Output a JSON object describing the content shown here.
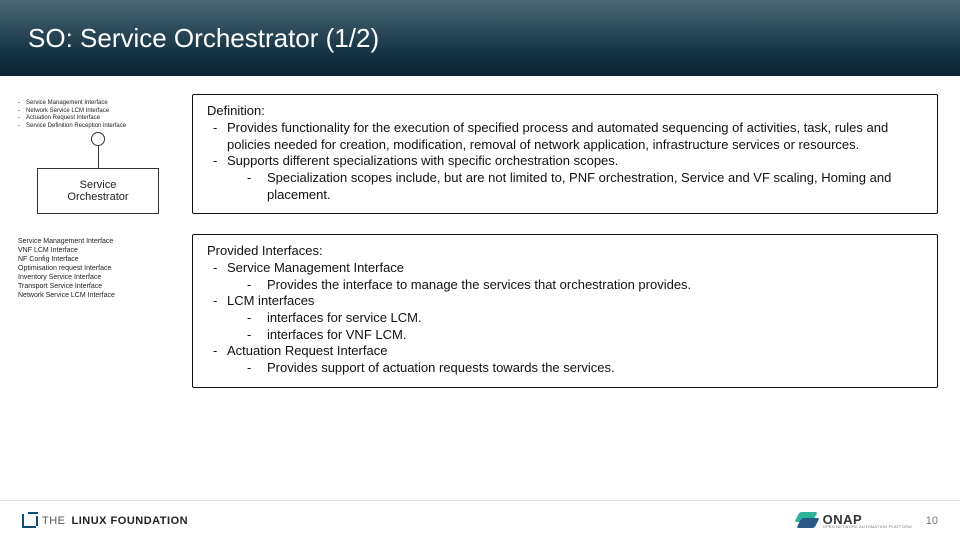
{
  "title": "SO: Service Orchestrator (1/2)",
  "top_iface": [
    "Service Management Interface",
    "Network Service LCM Interface",
    "Actuation Request Interface",
    "Service Definition Reception interface"
  ],
  "uml": {
    "l1": "Service",
    "l2": "Orchestrator"
  },
  "bottom_iface": [
    "Service Management Interface",
    "VNF LCM Interface",
    "NF Config Interface",
    "Optimisation request Interface",
    "Inventory Service Interface",
    "Transport Service Interface",
    "Network Service LCM Interface"
  ],
  "panel1": {
    "header": "Definition:",
    "items": [
      {
        "lvl": 1,
        "text": "Provides functionality for the execution of specified process and automated sequencing of activities, task, rules and policies needed for creation, modification, removal of network application, infrastructure services or resources."
      },
      {
        "lvl": 1,
        "text": "Supports different specializations with specific orchestration scopes."
      },
      {
        "lvl": 2,
        "text": "Specialization scopes include, but are not limited to, PNF orchestration, Service and VF scaling, Homing and placement."
      }
    ]
  },
  "panel2": {
    "header": "Provided Interfaces:",
    "items": [
      {
        "lvl": 1,
        "text": "Service Management Interface"
      },
      {
        "lvl": 2,
        "text": "Provides the interface to manage the services that orchestration provides."
      },
      {
        "lvl": 1,
        "text": "LCM interfaces"
      },
      {
        "lvl": 2,
        "text": "interfaces for service LCM."
      },
      {
        "lvl": 2,
        "text": "interfaces for VNF LCM."
      },
      {
        "lvl": 1,
        "text": "Actuation Request Interface"
      },
      {
        "lvl": 2,
        "text": "Provides support of actuation requests towards the services."
      }
    ]
  },
  "footer": {
    "lf_the": "THE",
    "lf_name": "LINUX FOUNDATION",
    "onap_brand": "ONAP",
    "onap_tag": "OPEN NETWORK AUTOMATION PLATFORM",
    "page": "10"
  }
}
